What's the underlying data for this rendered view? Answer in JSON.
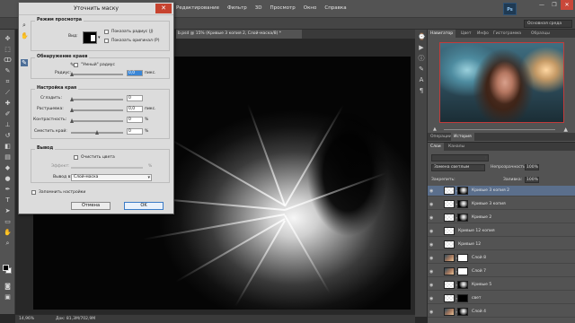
{
  "menubar": {
    "menus": [
      "Редактирование",
      "Фильтр",
      "3D",
      "Просмотр",
      "Окно",
      "Справка"
    ],
    "workspace_label": "Основная среда",
    "ps_label": "Ps",
    "win_controls": [
      "—",
      "❐",
      "✕"
    ]
  },
  "document": {
    "tab_title": "b.psd @ 15% (Кривые 3 копия 2, Слой-маска/8) *",
    "zoom": "14,96%",
    "doc_info": "Док: 81,3M/702,9M"
  },
  "dialog": {
    "title": "Уточнить маску",
    "close_label": "✕",
    "view_mode_group": "Режим просмотра",
    "view_label": "Вид:",
    "show_radius": "Показать радиус (J)",
    "show_original": "Показать оригинал (P)",
    "edge_detection_group": "Обнаружение краев",
    "smart_radius": "\"Умный\" радиус",
    "radius_label": "Радиус:",
    "radius_value": "0,0",
    "radius_unit": "пикс.",
    "adjust_edge_group": "Настройка края",
    "smooth_label": "Сгладить:",
    "smooth_value": "0",
    "feather_label": "Растушевка:",
    "feather_value": "0,0",
    "feather_unit": "пикс.",
    "contrast_label": "Контрастность:",
    "contrast_value": "0",
    "contrast_unit": "%",
    "shift_edge_label": "Сместить край:",
    "shift_edge_value": "0",
    "shift_edge_unit": "%",
    "output_group": "Вывод",
    "decontaminate": "Очистить цвета",
    "amount_label": "Эффект:",
    "amount_unit": "%",
    "output_to_label": "Вывод в:",
    "output_to_value": "Слой-маска",
    "remember": "Запомнить настройки",
    "cancel": "Отмена",
    "ok": "OK"
  },
  "panels": {
    "top_tabs": [
      "Навигатор",
      "Цвет",
      "Инфо",
      "Гистограмма",
      "Образцы"
    ],
    "mid_tabs": [
      "Операции",
      "История"
    ],
    "layer_tabs": [
      "Слои",
      "Каналы"
    ],
    "blend_mode": "Замена светлым",
    "opacity_label": "Непрозрачность:",
    "opacity_value": "100%",
    "lock_label": "Закрепить:",
    "fill_label": "Заливка:",
    "fill_value": "100%"
  },
  "layers": [
    {
      "name": "Кривые 3 копия 2",
      "thumb": "checker",
      "mask": "mix",
      "selected": true
    },
    {
      "name": "Кривые 3 копия",
      "thumb": "checker",
      "mask": "mix",
      "selected": false
    },
    {
      "name": "Кривые 2",
      "thumb": "checker",
      "mask": "mix",
      "selected": false
    },
    {
      "name": "Кривые 12 копия",
      "thumb": "checker",
      "mask": "none",
      "selected": false
    },
    {
      "name": "Кривые 12",
      "thumb": "checker",
      "mask": "none",
      "selected": false
    },
    {
      "name": "Слой 8",
      "thumb": "photo",
      "mask": "w",
      "selected": false
    },
    {
      "name": "Слой 7",
      "thumb": "photo",
      "mask": "w",
      "selected": false
    },
    {
      "name": "Кривые 5",
      "thumb": "checker",
      "mask": "mix",
      "selected": false
    },
    {
      "name": "свет",
      "thumb": "checker",
      "mask": "b",
      "selected": false
    },
    {
      "name": "Слой 4",
      "thumb": "photo",
      "mask": "mix",
      "selected": false
    }
  ]
}
